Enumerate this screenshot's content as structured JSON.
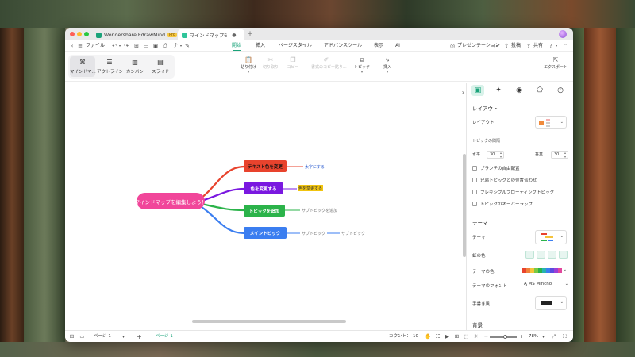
{
  "window": {
    "tabs": [
      {
        "label": "Wondershare EdrawMind",
        "badge": "Pro"
      },
      {
        "label": "マインドマップ6"
      }
    ],
    "new_tab": "+"
  },
  "menubar": {
    "file": "ファイル",
    "tabs": [
      "開始",
      "挿入",
      "ページスタイル",
      "アドバンスツール",
      "表示",
      "AI"
    ],
    "active_tab": "開始",
    "presentation": "プレゼンテーション",
    "publish": "投稿",
    "share": "共有"
  },
  "toolbar": {
    "views": [
      "マインドマ...",
      "アウトライン",
      "カンバン",
      "スライド"
    ],
    "buttons": {
      "paste": "貼り付け",
      "cut": "切り取り",
      "copy": "コピー",
      "format_copy": "書式のコピー貼り...",
      "topic": "トピック",
      "insert": "挿入",
      "export": "エクスポート"
    }
  },
  "mindmap": {
    "central": "マインドマップを編集しよう！",
    "branches": [
      {
        "label": "テキスト色を変更",
        "color": "#e8432d",
        "text_color": "#111111",
        "sub": [
          "太字にする"
        ],
        "sub_color": "#2f5fd0"
      },
      {
        "label": "色を変更する",
        "color": "#7a18e0",
        "text_color": "#ffffff",
        "sub": [
          "色を変更する"
        ],
        "sub_color": "#333333",
        "sub_bg": "#f1c40f"
      },
      {
        "label": "トピックを追加",
        "color": "#2bb34a",
        "text_color": "#ffffff",
        "sub": [
          "サブトピックを追加"
        ],
        "sub_color": "#777777"
      },
      {
        "label": "メイントピック",
        "color": "#3b7ef0",
        "text_color": "#ffffff",
        "sub": [
          "サブトピック",
          "サブトピック"
        ],
        "sub_color": "#777777"
      }
    ],
    "central_color": "#f1469a"
  },
  "panel": {
    "layout_title": "レイアウト",
    "layout_label": "レイアウト",
    "spacing_label": "トピックの間隔",
    "horizontal_label": "水平",
    "horizontal_value": "30",
    "vertical_label": "垂直",
    "vertical_value": "30",
    "checkboxes": [
      "ブランチの自由配置",
      "兄弟トピックとの位置合わせ",
      "フレキシブルフローティングトピック",
      "トピックのオーバーラップ"
    ],
    "theme_title": "テーマ",
    "theme_label": "テーマ",
    "line_color_label": "虹の色",
    "theme_color_label": "テーマの色",
    "theme_font_label": "テーマのフォント",
    "theme_font_value": "MS Mincho",
    "hand_drawn_label": "手書き風",
    "background_title": "背景",
    "palette": [
      "#e8432d",
      "#f0813a",
      "#f5c33b",
      "#7ac943",
      "#2bb34a",
      "#27b3b0",
      "#3b7ef0",
      "#5b4be0",
      "#9b3fd6",
      "#e2469d"
    ]
  },
  "statusbar": {
    "page_select": "ページ-1",
    "active_page": "ページ-1",
    "count_label": "カウント：",
    "count_value": "10",
    "zoom": "78%",
    "zoom_level": 0.78
  }
}
